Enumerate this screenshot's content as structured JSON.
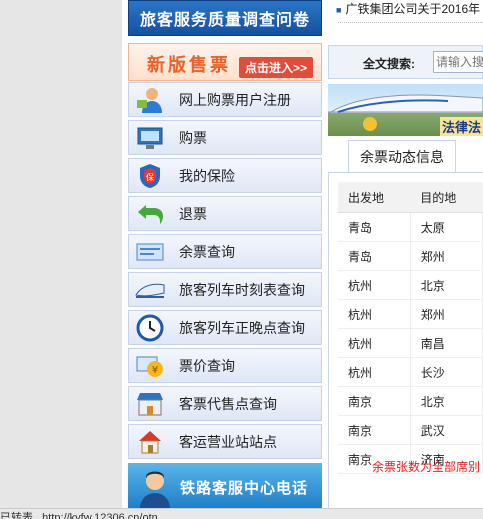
{
  "left": {
    "survey_banner": "旅客服务质量调查问卷",
    "new_ticket_banner": {
      "title": "新版售票",
      "enter": "点击进入>>"
    },
    "menu": [
      {
        "label": "网上购票用户注册",
        "icon": "user-register-icon"
      },
      {
        "label": "购票",
        "icon": "computer-ticket-icon"
      },
      {
        "label": "我的保险",
        "icon": "insurance-shield-icon"
      },
      {
        "label": "退票",
        "icon": "refund-arrow-icon"
      },
      {
        "label": "余票查询",
        "icon": "remaining-ticket-icon"
      },
      {
        "label": "旅客列车时刻表查询",
        "icon": "train-schedule-icon"
      },
      {
        "label": "旅客列车正晚点查询",
        "icon": "clock-icon"
      },
      {
        "label": "票价查询",
        "icon": "price-yen-icon"
      },
      {
        "label": "客票代售点查询",
        "icon": "ticket-agency-icon"
      },
      {
        "label": "客运营业站站点",
        "icon": "station-house-icon"
      }
    ],
    "hotline_banner": "铁路客服中心电话"
  },
  "right": {
    "news": "广铁集团公司关于2016年",
    "search": {
      "label": "全文搜索:",
      "placeholder": "请输入搜"
    },
    "train_banner_text": "法律法",
    "tab_label": "余票动态信息",
    "table": {
      "headers": [
        "出发地",
        "目的地"
      ],
      "rows": [
        [
          "青岛",
          "太原"
        ],
        [
          "青岛",
          "郑州"
        ],
        [
          "杭州",
          "北京"
        ],
        [
          "杭州",
          "郑州"
        ],
        [
          "杭州",
          "南昌"
        ],
        [
          "杭州",
          "长沙"
        ],
        [
          "南京",
          "北京"
        ],
        [
          "南京",
          "武汉"
        ],
        [
          "南京",
          "济南"
        ]
      ],
      "note": "余票张数为全部席别"
    }
  },
  "statusbar": "已转表...http://kyfw.12306.cn/otn",
  "colors": {
    "accent_blue": "#1551a0",
    "note_red": "#e02020",
    "menu_bg": "#dfe7f5"
  }
}
